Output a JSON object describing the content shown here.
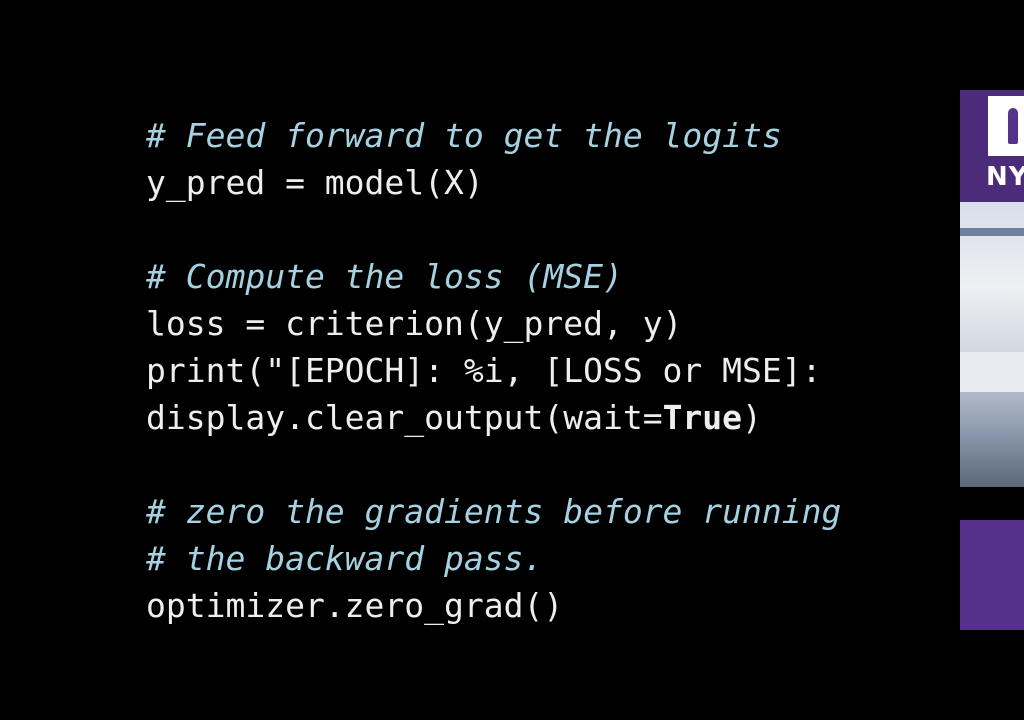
{
  "code_lines": [
    {
      "type": "comment",
      "text": "# Feed forward to get the logits"
    },
    {
      "type": "code",
      "text": "y_pred = model(X)"
    },
    {
      "type": "blank",
      "text": ""
    },
    {
      "type": "comment",
      "text": "# Compute the loss (MSE)"
    },
    {
      "type": "code",
      "text": "loss = criterion(y_pred, y)"
    },
    {
      "type": "code",
      "text": "print(\"[EPOCH]: %i, [LOSS or MSE]: "
    },
    {
      "type": "code_kw",
      "before": "display.clear_output(wait=",
      "keyword": "True",
      "after": ")"
    },
    {
      "type": "blank",
      "text": ""
    },
    {
      "type": "comment",
      "text": "# zero the gradients before running"
    },
    {
      "type": "comment",
      "text": "# the backward pass."
    },
    {
      "type": "code",
      "text": "optimizer.zero_grad()"
    }
  ],
  "webcam": {
    "brand_text": "NY"
  },
  "colors": {
    "background": "#000000",
    "code_text": "#eeeeee",
    "comment_text": "#a5d1e1",
    "brand_purple": "#57308b"
  }
}
